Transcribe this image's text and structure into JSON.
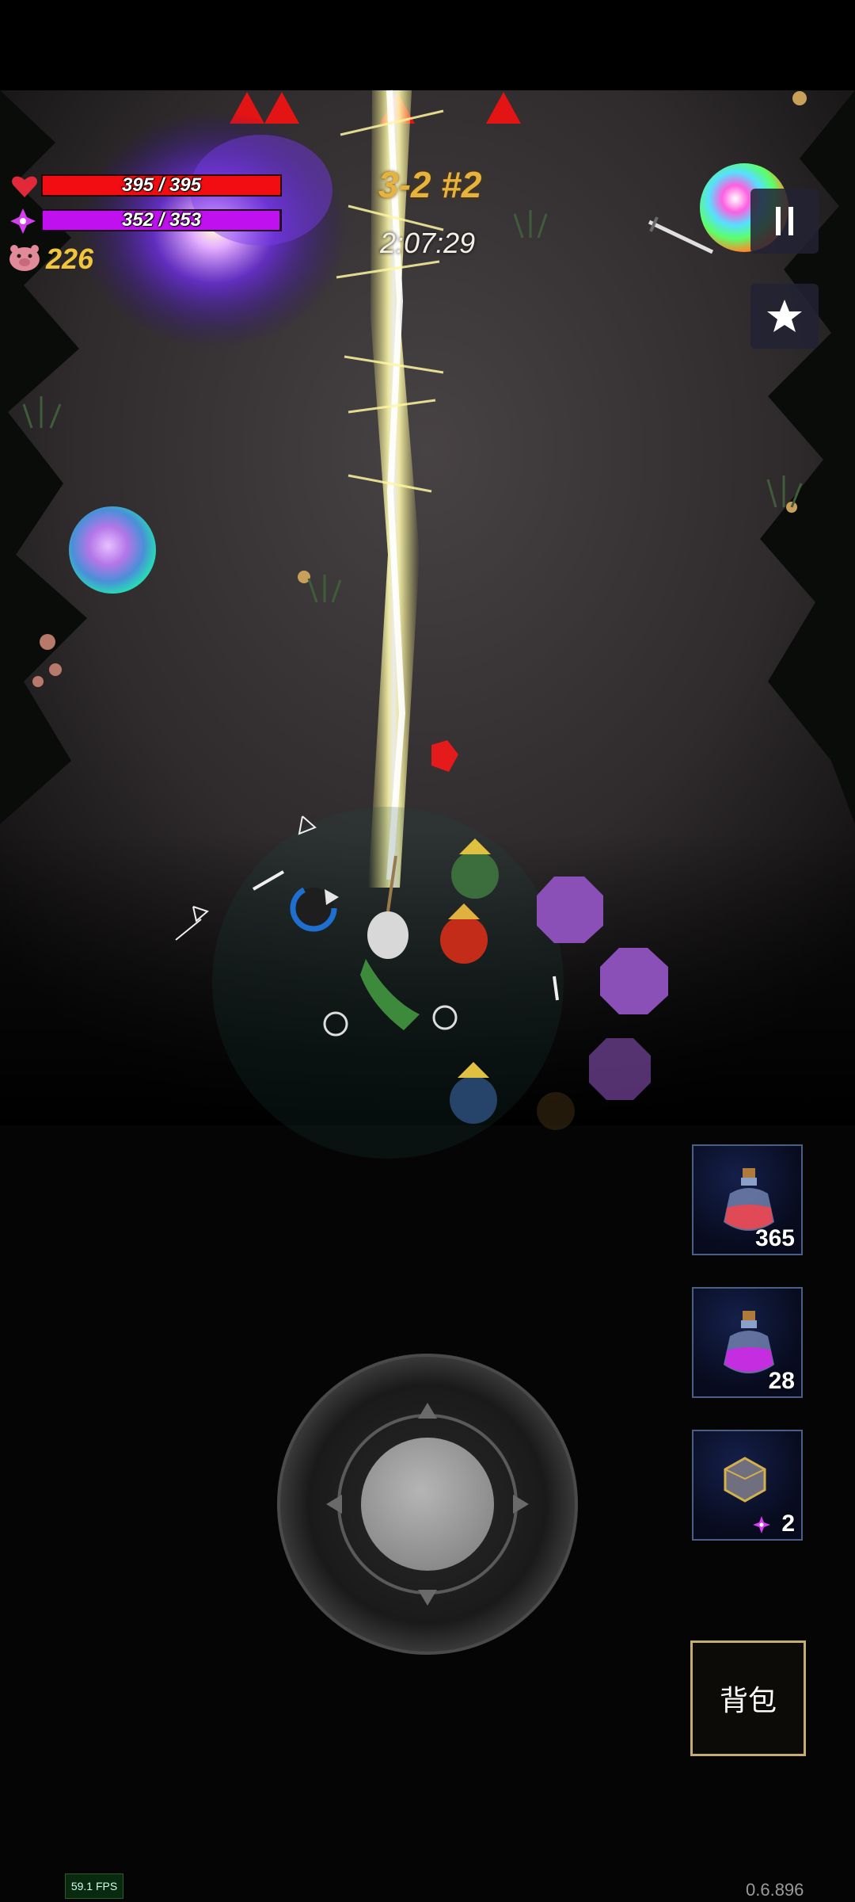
{
  "stats": {
    "hp": {
      "current": 395,
      "max": 395,
      "text": "395 / 395",
      "color": "#f10d12"
    },
    "mp": {
      "current": 352,
      "max": 353,
      "text": "352 / 353",
      "color": "#c010f0"
    },
    "coins": "226"
  },
  "stage": {
    "label": "3-2 #2",
    "timer": "2:07:29"
  },
  "buttons": {
    "pause_icon": "pause-icon",
    "star_icon": "star-icon",
    "backpack_label": "背包"
  },
  "items": [
    {
      "name": "health-potion",
      "icon": "red-potion-icon",
      "count": "365"
    },
    {
      "name": "mana-potion",
      "icon": "purple-potion-icon",
      "count": "28"
    },
    {
      "name": "gem-item",
      "icon": "d20-gem-icon",
      "count": "2"
    }
  ],
  "fps": "59.1 FPS",
  "version": "0.6.896",
  "warning_markers": 4,
  "colors": {
    "accent_gold": "#c6ad74",
    "lightning": "#ffff8a"
  }
}
